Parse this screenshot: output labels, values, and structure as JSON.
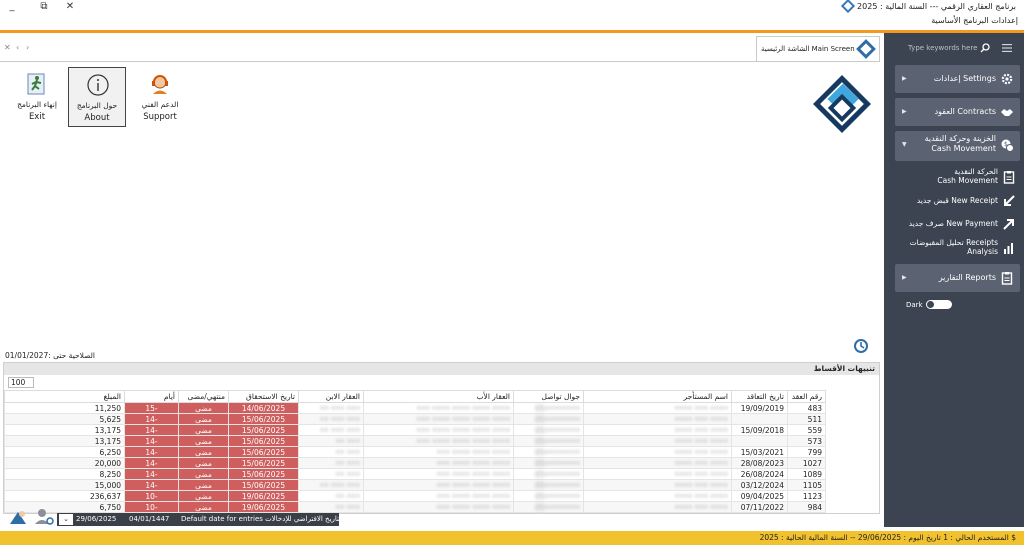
{
  "window": {
    "title": "برنامج العقاري الرقمي --- السنة المالية : 2025",
    "subtitle": "إعدادات البرنامج الأساسية"
  },
  "sidebar": {
    "search_placeholder": "Type keywords here",
    "items": [
      {
        "label": "إعدادات Settings"
      },
      {
        "label": "العقود Contracts"
      },
      {
        "label_ar": "الخزينة وحركة النقدية",
        "label_en": "Cash Movement"
      }
    ],
    "subitems": [
      {
        "label_ar": "الحركة النقدية",
        "label_en": "Cash Movement"
      },
      {
        "label": "قبض جديد New Receipt"
      },
      {
        "label": "صرف جديد New Payment"
      },
      {
        "label_ar": "تحليل المقبوضات Receipts",
        "label_en": "Analysis"
      }
    ],
    "reports": {
      "label": "التقارير Reports"
    },
    "dark_label": "Dark"
  },
  "tab": {
    "label": "الشاشة الرئيسية  Main Screen"
  },
  "tabstrip": {
    "close": "✕",
    "prev": "‹",
    "next": "›"
  },
  "toolbar": [
    {
      "ar": "إنهاء البرنامج",
      "en": "Exit"
    },
    {
      "ar": "حول البرنامج",
      "en": "About"
    },
    {
      "ar": "الدعم الفني",
      "en": "Support"
    }
  ],
  "validity": "الصلاحية حتى :01/01/2027",
  "alerts": {
    "title": "تنبيهات الأقساط",
    "count": "100",
    "columns": [
      "رقم العقد",
      "تاريخ التعاقد",
      "اسم المستأجر",
      "جوال تواصل",
      "العقار الأب",
      "العقار الابن",
      "تاريخ الاستحقاق",
      "منتهي/مضى",
      "أيام",
      "المبلغ"
    ],
    "rows": [
      [
        "483",
        "19/09/2019",
        "•••• ••• ••••",
        "05••••••••",
        "••• •••• •••• •••• ••••",
        "•• ••• •••",
        "14/06/2025",
        "مضى",
        "15-",
        "11,250"
      ],
      [
        "511",
        "",
        "•••• ••• ••••",
        "05••••••••",
        "••• •••• •••• •••• ••••",
        "•• ••• •••",
        "15/06/2025",
        "مضى",
        "14-",
        "5,625"
      ],
      [
        "559",
        "15/09/2018",
        "•••• ••• ••••",
        "05••••••••",
        "••• •••• •••• •••• ••••",
        "•• ••• •••",
        "15/06/2025",
        "مضى",
        "14-",
        "13,175"
      ],
      [
        "573",
        "",
        "•••• ••• ••••",
        "05••••••••",
        "••• •••• •••• •••• ••••",
        "•• •••",
        "15/06/2025",
        "مضى",
        "14-",
        "13,175"
      ],
      [
        "799",
        "15/03/2021",
        "•••• ••• ••••",
        "05••••••••",
        "••• •••• •••• ••••",
        "•• •••",
        "15/06/2025",
        "مضى",
        "14-",
        "6,250"
      ],
      [
        "1027",
        "28/08/2023",
        "•••• ••• ••••",
        "05••••••••",
        "••• •••• •••• ••••",
        "•• •••",
        "15/06/2025",
        "مضى",
        "14-",
        "20,000"
      ],
      [
        "1089",
        "26/08/2024",
        "•••• ••• ••••",
        "05••••••••",
        "••• •••• •••• ••••",
        "•• •••",
        "15/06/2025",
        "مضى",
        "14-",
        "8,250"
      ],
      [
        "1105",
        "03/12/2024",
        "•••• ••• ••••",
        "05••••••••",
        "••• •••• •••• ••••",
        "•• ••• •••",
        "15/06/2025",
        "مضى",
        "14-",
        "15,000"
      ],
      [
        "1123",
        "09/04/2025",
        "•••• ••• ••••",
        "05••••••••",
        "••• •••• •••• ••••",
        "•• •••",
        "19/06/2025",
        "مضى",
        "10-",
        "236,637"
      ],
      [
        "984",
        "07/11/2022",
        "•••• ••• ••••",
        "05••••••••",
        "••• •••• •••• ••••",
        "•• •••",
        "19/06/2025",
        "مضى",
        "10-",
        "6,750"
      ]
    ]
  },
  "datebar": {
    "gregorian": "29/06/2025",
    "hijri": "04/01/1447",
    "label": "Default date for entries  التاريخ الافتراضي للإدخالات",
    "dropdown": "⌄"
  },
  "footer": {
    "text": "$   المستخدم الحالي : 1   تاريخ اليوم : 29/06/2025   --   السنة المالية الحالية : 2025"
  },
  "colors": {
    "accent": "#f39a1e",
    "sidebar": "#3c4451",
    "overdue": "#cf5f5f",
    "footer": "#f2c12e"
  }
}
